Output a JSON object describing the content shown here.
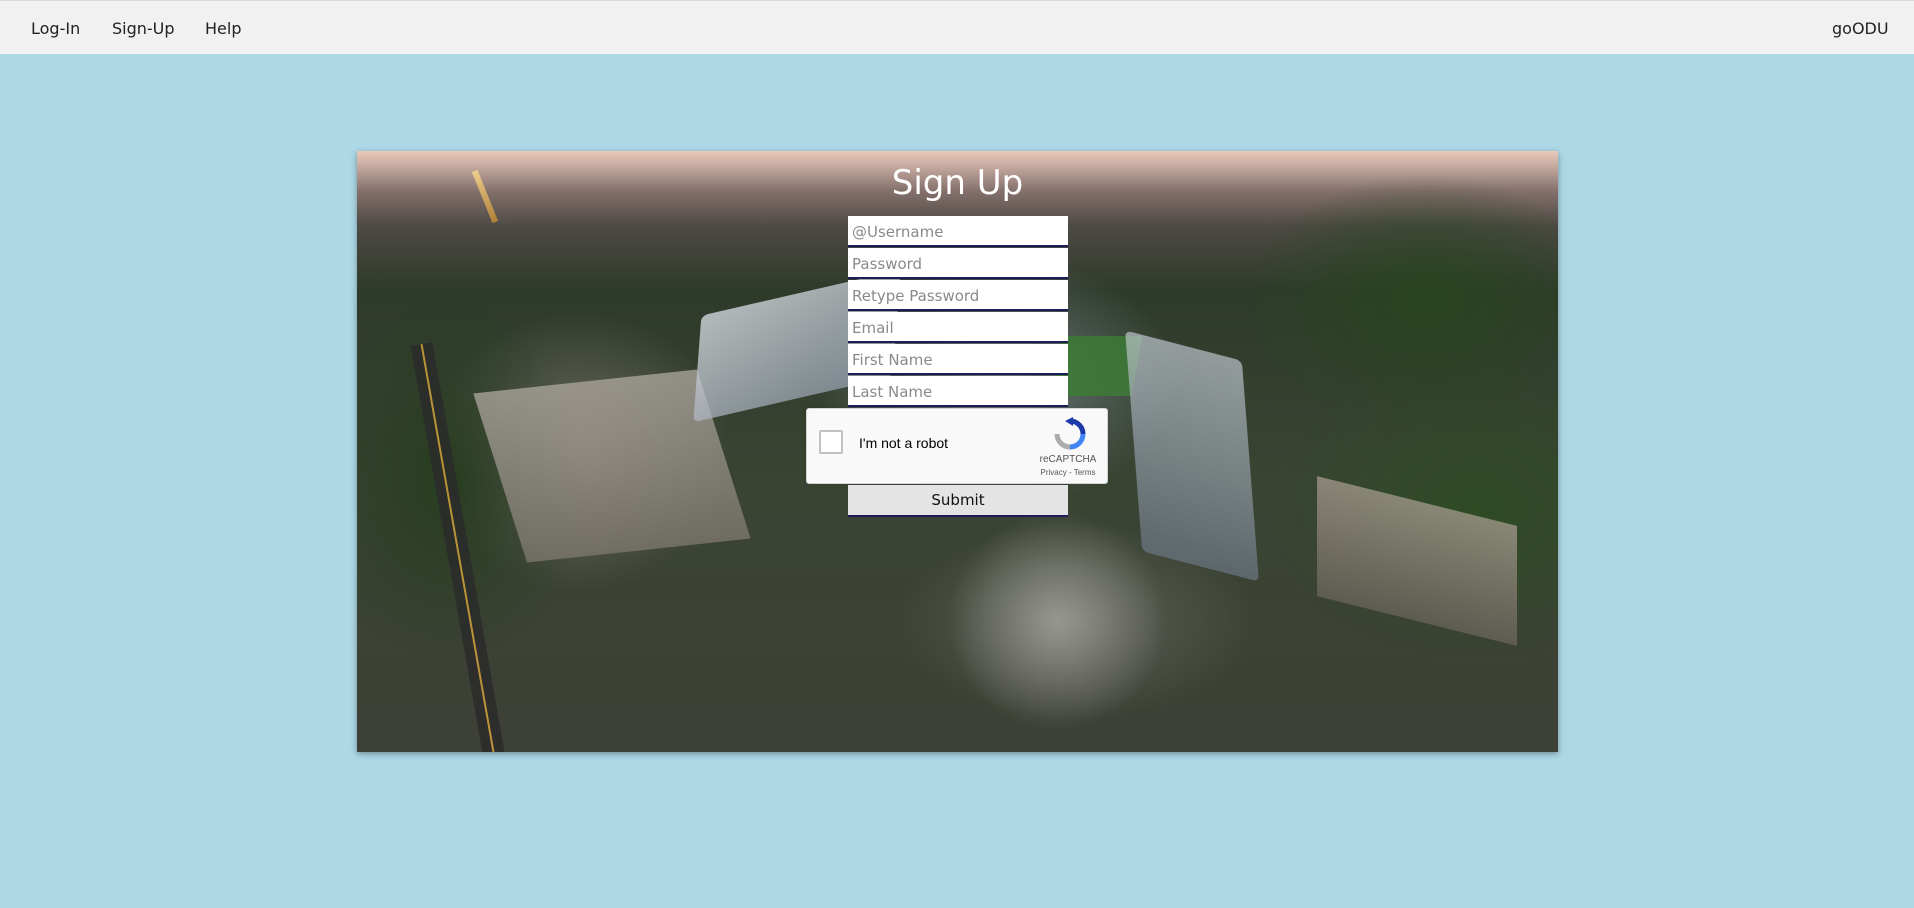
{
  "nav": {
    "login_label": "Log-In",
    "signup_label": "Sign-Up",
    "help_label": "Help",
    "brand_label": "goODU"
  },
  "form": {
    "title": "Sign Up",
    "username_placeholder": "@Username",
    "password_placeholder": "Password",
    "retype_password_placeholder": "Retype Password",
    "email_placeholder": "Email",
    "first_name_placeholder": "First Name",
    "last_name_placeholder": "Last Name",
    "submit_label": "Submit"
  },
  "captcha": {
    "label": "I'm not a robot",
    "brand": "reCAPTCHA",
    "privacy_label": "Privacy",
    "separator": " - ",
    "terms_label": "Terms"
  },
  "colors": {
    "page_background": "#add8e6",
    "topbar_background": "#f1f1f1",
    "field_underline": "#1d1d5a"
  }
}
